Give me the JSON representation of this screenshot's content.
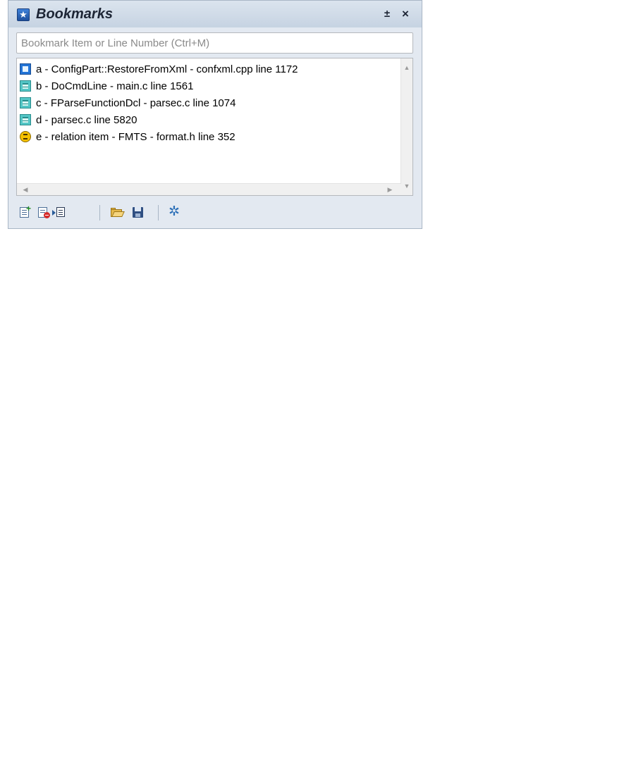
{
  "panel": {
    "title": "Bookmarks",
    "pin_glyph": "±",
    "close_glyph": "×"
  },
  "search": {
    "placeholder": "Bookmark Item or Line Number (Ctrl+M)",
    "value": ""
  },
  "bookmarks": [
    {
      "icon": "class-icon",
      "label": "a - ConfigPart::RestoreFromXml - confxml.cpp line 1172"
    },
    {
      "icon": "function-icon",
      "label": "b - DoCmdLine - main.c line 1561"
    },
    {
      "icon": "function-icon",
      "label": "c - FParseFunctionDcl - parsec.c line 1074"
    },
    {
      "icon": "function-icon",
      "label": "d - parsec.c line 5820"
    },
    {
      "icon": "relation-icon",
      "label": "e - relation item - FMTS - format.h line 352"
    }
  ],
  "toolbar": {
    "buttons": [
      "add-bookmark-icon",
      "delete-bookmark-icon",
      "go-to-bookmark-icon",
      "open-folder-icon",
      "save-icon",
      "settings-gear-icon"
    ]
  },
  "colors": {
    "title_bar": "#c6d3e2",
    "panel_bg": "#e3e9f1",
    "class_icon": "#2374d6",
    "function_icon": "#53c6c6",
    "relation_icon": "#f5c000"
  }
}
